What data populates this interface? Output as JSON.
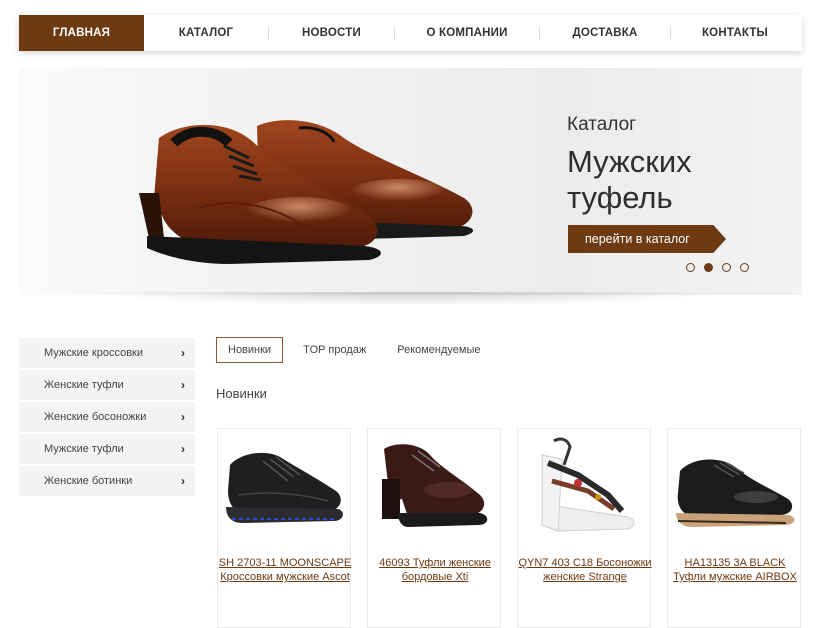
{
  "nav": {
    "items": [
      {
        "label": "ГЛАВНАЯ",
        "active": true
      },
      {
        "label": "КАТАЛОГ",
        "active": false
      },
      {
        "label": "НОВОСТИ",
        "active": false
      },
      {
        "label": "О КОМПАНИИ",
        "active": false
      },
      {
        "label": "ДОСТАВКА",
        "active": false
      },
      {
        "label": "КОНТАКТЫ",
        "active": false
      }
    ]
  },
  "banner": {
    "subtitle": "Каталог",
    "title": "Мужских туфель",
    "cta": "перейти в каталог",
    "slides_total": 4,
    "active_slide": 2
  },
  "sidebar": {
    "items": [
      "Мужские кроссовки",
      "Женские туфли",
      "Женские босоножки",
      "Мужские туфли",
      "Женские ботинки"
    ]
  },
  "tabs": [
    {
      "label": "Новинки",
      "active": true
    },
    {
      "label": "TOP продаж",
      "active": false
    },
    {
      "label": "Рекомендуемые",
      "active": false
    }
  ],
  "section_title": "Новинки",
  "products": [
    {
      "name": "SH 2703-11 MOONSCAPE Кроссовки мужские Ascot",
      "icon": "black-sneaker-icon"
    },
    {
      "name": "46093 Туфли женские бордовые Xti",
      "icon": "burgundy-heel-boot-icon"
    },
    {
      "name": "QYN7 403 C18 Босоножки женские Strange",
      "icon": "wedge-sandal-icon"
    },
    {
      "name": "HA13135 3A BLACK Туфли мужские AIRBOX",
      "icon": "black-oxford-shoe-icon"
    }
  ],
  "colors": {
    "accent": "#6e3a12",
    "sidebar_bg": "#f4f4f4"
  }
}
